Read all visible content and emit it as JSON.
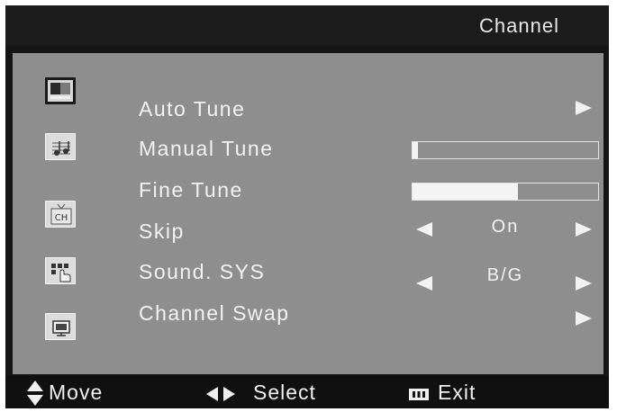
{
  "header": {
    "title": "Channel"
  },
  "sidebar": {
    "icons": [
      {
        "name": "picture-icon",
        "selected": true
      },
      {
        "name": "sound-icon",
        "selected": false
      },
      {
        "name": "channel-icon",
        "label": "CH",
        "selected": false
      },
      {
        "name": "function-icon",
        "selected": false
      },
      {
        "name": "screen-icon",
        "selected": false
      }
    ]
  },
  "menu": {
    "items": [
      {
        "label": "Auto Tune"
      },
      {
        "label": "Manual Tune",
        "level": 0.03
      },
      {
        "label": "Fine Tune",
        "level": 0.57
      },
      {
        "label": "Skip",
        "value": "On"
      },
      {
        "label": "Sound. SYS",
        "value": "B/G"
      },
      {
        "label": "Channel Swap"
      }
    ]
  },
  "footer": {
    "move_label": "Move",
    "select_label": "Select",
    "exit_label": "Exit"
  },
  "colors": {
    "panel": "#8e8e8e",
    "background": "#151515",
    "text": "#f2f2f2"
  }
}
